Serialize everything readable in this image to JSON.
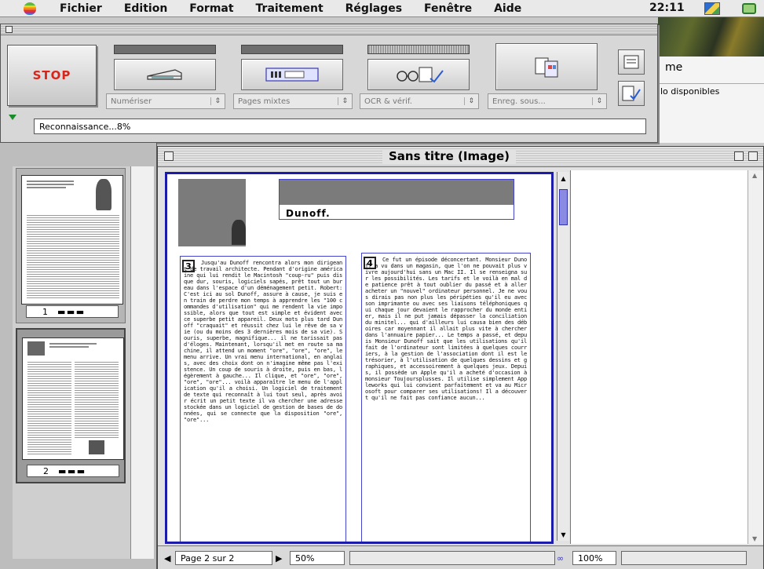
{
  "menubar": {
    "items": [
      "Fichier",
      "Edition",
      "Format",
      "Traitement",
      "Réglages",
      "Fenêtre",
      "Aide"
    ],
    "clock": "22:11"
  },
  "background_window": {
    "title": "me",
    "subtitle": "lo disponibles"
  },
  "palette": {
    "stop_label": "STOP",
    "stages": [
      {
        "label": "Numériser",
        "progress": "complete"
      },
      {
        "label": "Pages mixtes",
        "progress": "complete"
      },
      {
        "label": "OCR & vérif.",
        "progress": "in-progress"
      },
      {
        "label": "Enreg. sous...",
        "progress": "pending"
      }
    ],
    "status_text": "Reconnaissance...8%"
  },
  "thumbnails": {
    "pages": [
      {
        "number": "1",
        "title": "LES BRIGADES DE JOUTEVILLE DE ROBOT"
      },
      {
        "number": "2",
        "title": "Les aventures de Monsieur Dunoff"
      }
    ],
    "selected": "2"
  },
  "image_window": {
    "title": "Sans titre (Image)",
    "page_indicator": "Page 2 sur 2",
    "zoom": "50%",
    "text_zoom": "100%",
    "heading": "Dunoff.",
    "zone_numbers": [
      "3",
      "4"
    ],
    "column1_text": "Jusqu'au Dunoff rencontra alors mon dirigeant de travail architecte. Pendant d'origine américaine qui lui rendit le Macintosh \"coup-ru\" puis disque dur, souris, logiciels sapés, prêt tout un bureau dans l'espace d'un déménagement petit. Robert: C'est ici au sol Dunoff, assure à cause, je suis en train de perdre mon temps à apprendre les \"100 commandes d'utilisation\" qui me rendent la vie impossible, alors que tout est simple et évident avec ce superbe petit appareil. Deux mots plus tard Dunoff \"craquait\" et réussit chez lui le rêve de sa vie (ou du moins des 3 dernières mois de sa vie). Souris, superbe, magnifique... il ne tarissait pas d'éloges. Maintenant, lorsqu'il met en route sa machine, il attend un moment \"ore\", \"ore\", \"ore\", le menu arrive. Un vrai menu international, en anglais, avec des choix dont on n'imagine même pas l'existence. Un coup de souris à droite, puis en bas, légèrement à gauche... Il clique, et \"ore\", \"ore\", \"ore\", \"ore\"... voilà apparaître le menu de l'application qu'il a choisi. Un logiciel de traitement de texte qui reconnaît à lui tout seul, après avoir écrit un petit texte il va chercher une adresse stockée dans un logiciel de gestion de bases de données, qui se connecte que la disposition \"ore\", \"ore\"...",
    "column2_text": "Ce fut un épisode déconcertant. Monsieur Dunoff a vu dans un magasin, que l'on ne pouvait plus vivre aujourd'hui sans un Mac II. Il se renseigna sur les possibilités. Les tarifs et le voilà en mal de patience prêt à tout oublier du passé et à aller acheter un \"nouvel\" ordinateur personnel. Je ne vous dirais pas non plus les péripéties qu'il eu avec son imprimante ou avec ses liaisons téléphoniques qui chaque jour devaient le rapprocher du monde entier, mais il ne put jamais dépasser la conciliation du minitel... qui d'ailleurs lui causa bien des déboires car moyennant il allait plus vite à chercher dans l'annuaire papier... Le temps a passé, et depuis Monsieur Dunoff sait que les utilisations qu'il fait de l'ordinateur sont limitées à quelques courriers, à la gestion de l'association dont il est le trésorier, à l'utilisation de quelques dessins et graphiques, et accessoirement à quelques jeux. Depuis, il possède un Apple qu'il a acheté d'occasion à monsieur Toujoursplusses. Il utilise simplement Appleworks qui lui convient parfaitement et va au Microsoft pour comparer ses utilisations! Il a découvert qu'il ne fait pas confiance aucun..."
  }
}
